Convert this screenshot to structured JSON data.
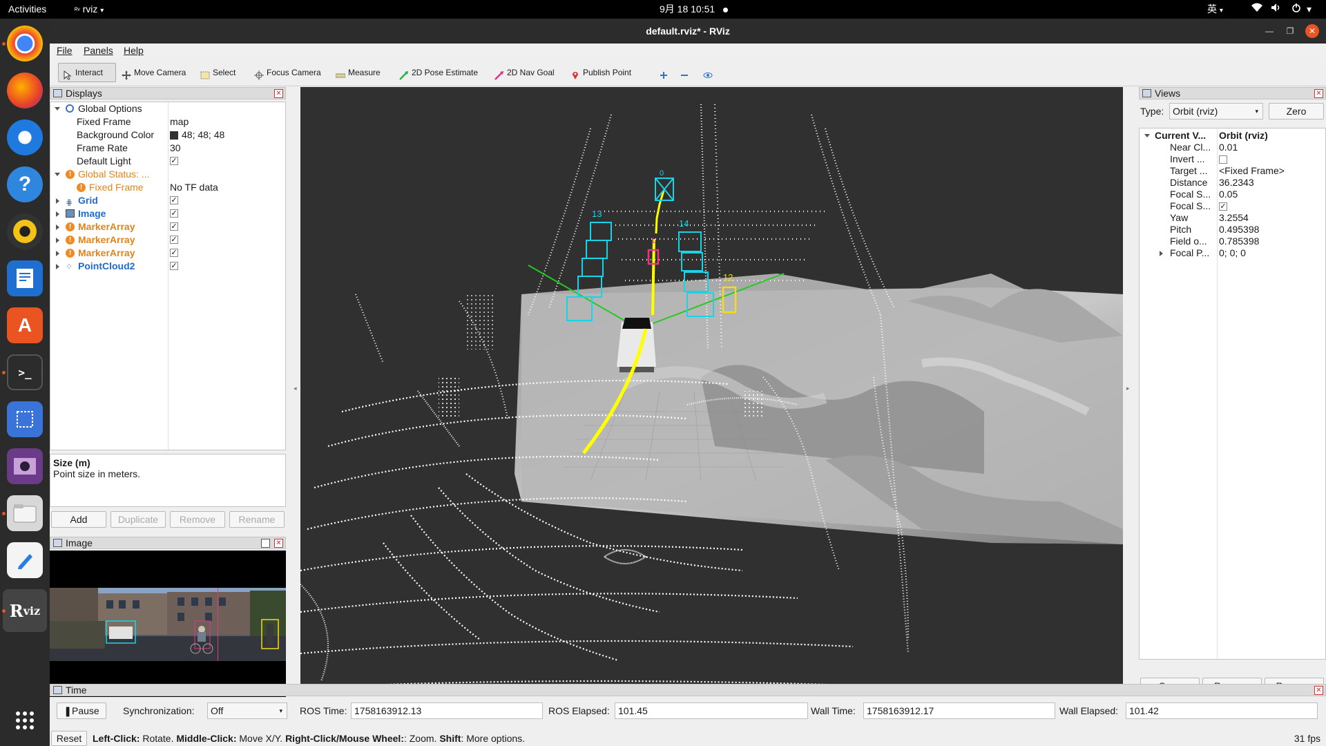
{
  "topbar": {
    "activities": "Activities",
    "app_name": "rviz",
    "datetime": "9月 18  10:51",
    "input_method": "英"
  },
  "dock": {
    "items": [
      "chrome-icon",
      "firefox-icon",
      "thunderbird-icon",
      "help-icon",
      "rhythmbox-icon",
      "writer-icon",
      "software-icon",
      "terminal-icon",
      "screenshot-icon",
      "video-icon",
      "files-icon",
      "text-editor-icon",
      "rviz-icon",
      "app-grid-icon"
    ]
  },
  "window": {
    "title": "default.rviz* - RViz"
  },
  "menu": {
    "file": "File",
    "panels": "Panels",
    "help": "Help"
  },
  "toolbar": {
    "interact": "Interact",
    "move_camera": "Move Camera",
    "select": "Select",
    "focus_camera": "Focus Camera",
    "measure": "Measure",
    "pose_estimate": "2D Pose Estimate",
    "nav_goal": "2D Nav Goal",
    "publish_point": "Publish Point"
  },
  "displays": {
    "title": "Displays",
    "global_options": "Global Options",
    "fixed_frame_label": "Fixed Frame",
    "fixed_frame_value": "map",
    "bg_color_label": "Background Color",
    "bg_color_value": "48; 48; 48",
    "frame_rate_label": "Frame Rate",
    "frame_rate_value": "30",
    "default_light_label": "Default Light",
    "global_status": "Global Status: ...",
    "status_fixed_frame": "Fixed Frame",
    "status_fixed_frame_value": "No TF data",
    "grid": "Grid",
    "image": "Image",
    "marker1": "MarkerArray",
    "marker2": "MarkerArray",
    "marker3": "MarkerArray",
    "pointcloud": "PointCloud2"
  },
  "description": {
    "title": "Size (m)",
    "text": "Point size in meters."
  },
  "display_buttons": {
    "add": "Add",
    "duplicate": "Duplicate",
    "remove": "Remove",
    "rename": "Rename"
  },
  "image_panel": {
    "title": "Image"
  },
  "views": {
    "title": "Views",
    "type_label": "Type:",
    "type_value": "Orbit (rviz)",
    "zero": "Zero",
    "current_label": "Current V...",
    "current_value": "Orbit (rviz)",
    "rows": [
      {
        "name": "Near Cl...",
        "value": "0.01"
      },
      {
        "name": "Invert ...",
        "value": ""
      },
      {
        "name": "Target ...",
        "value": "<Fixed Frame>"
      },
      {
        "name": "Distance",
        "value": "36.2343"
      },
      {
        "name": "Focal S...",
        "value": "0.05"
      },
      {
        "name": "Focal S...",
        "value": ""
      },
      {
        "name": "Yaw",
        "value": "3.2554"
      },
      {
        "name": "Pitch",
        "value": "0.495398"
      },
      {
        "name": "Field o...",
        "value": "0.785398"
      },
      {
        "name": "Focal P...",
        "value": "0; 0; 0"
      }
    ],
    "save": "Save",
    "remove": "Remove",
    "rename": "Rename"
  },
  "time": {
    "title": "Time",
    "pause": "Pause",
    "sync_label": "Synchronization:",
    "sync_value": "Off",
    "ros_time_label": "ROS Time:",
    "ros_time": "1758163912.13",
    "ros_elapsed_label": "ROS Elapsed:",
    "ros_elapsed": "101.45",
    "wall_time_label": "Wall Time:",
    "wall_time": "1758163912.17",
    "wall_elapsed_label": "Wall Elapsed:",
    "wall_elapsed": "101.42"
  },
  "status": {
    "reset": "Reset",
    "left_click_key": "Left-Click:",
    "left_click": " Rotate. ",
    "middle_click_key": "Middle-Click:",
    "middle_click": " Move X/Y. ",
    "right_click_key": "Right-Click/Mouse Wheel:",
    "right_click": ": Zoom. ",
    "shift_key": "Shift",
    "shift": ": More options.",
    "fps": "31 fps"
  },
  "scene": {
    "marker_ids": [
      "0",
      "13",
      "14",
      "1",
      "12"
    ],
    "colors": {
      "background": "#303030",
      "car_marker": "#19d3e6",
      "ped_marker": "#e83585",
      "cyclist_marker": "#f5dd14",
      "path": "#ffff00",
      "axis": "#1fcc1f"
    }
  }
}
